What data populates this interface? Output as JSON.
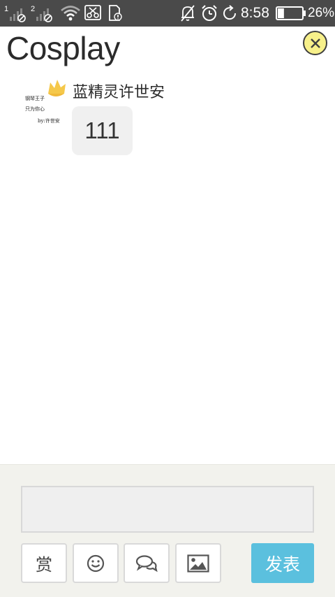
{
  "status_bar": {
    "sim1_label": "1",
    "sim2_label": "2",
    "time": "8:58",
    "battery_percent": "26%",
    "battery_level": 0.26,
    "icons": [
      "signal-sim1-icon",
      "signal-sim2-icon",
      "wifi-icon",
      "scissors-icon",
      "sd-card-icon",
      "mute-bell-icon",
      "alarm-icon",
      "sync-icon",
      "battery-charging-icon"
    ]
  },
  "header": {
    "title": "Cosplay",
    "close_icon": "close-icon",
    "close_color": "#f7f08a"
  },
  "message": {
    "avatar_lines": [
      "钢琴王子",
      "只为你心",
      "by:许世安"
    ],
    "avatar_icon": "crown-icon",
    "username": "蓝精灵许世安",
    "text": "111"
  },
  "composer": {
    "input_value": "",
    "tools": [
      {
        "name": "reward-button",
        "label": "赏"
      },
      {
        "name": "emoji-button",
        "icon": "smiley-icon"
      },
      {
        "name": "chat-button",
        "icon": "chat-bubbles-icon"
      },
      {
        "name": "image-button",
        "icon": "image-icon"
      }
    ],
    "send_label": "发表",
    "send_color": "#5bc0de"
  }
}
